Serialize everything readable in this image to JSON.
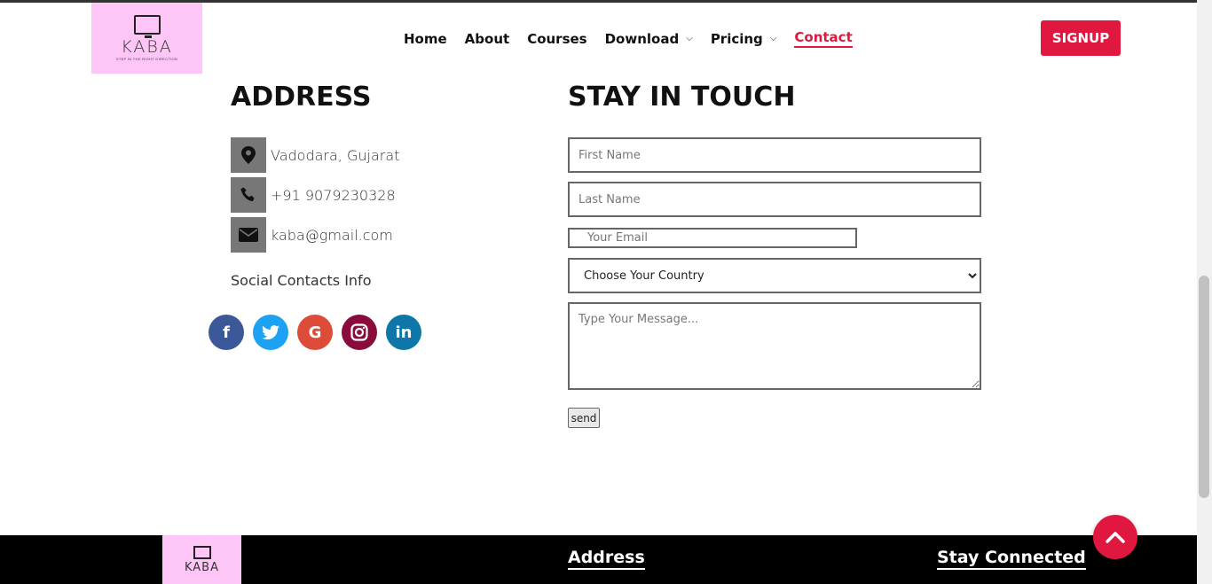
{
  "brand": {
    "name": "KABA",
    "tagline": "STEP IN THE RIGHT DIRECTION"
  },
  "nav": {
    "items": [
      {
        "label": "Home",
        "dropdown": false,
        "active": false
      },
      {
        "label": "About",
        "dropdown": false,
        "active": false
      },
      {
        "label": "Courses",
        "dropdown": false,
        "active": false
      },
      {
        "label": "Download",
        "dropdown": true,
        "active": false
      },
      {
        "label": "Pricing",
        "dropdown": true,
        "active": false
      },
      {
        "label": "Contact",
        "dropdown": false,
        "active": true
      }
    ],
    "signup_label": "SIGNUP"
  },
  "address": {
    "heading": "ADDRESS",
    "location": "Vadodara, Gujarat",
    "phone": "+91 9079230328",
    "email": "kaba@gmail.com",
    "social_label": "Social Contacts Info",
    "socials": [
      {
        "name": "facebook",
        "glyph": "f",
        "color": "#3b5998"
      },
      {
        "name": "twitter",
        "glyph": "t",
        "color": "#1da1f2"
      },
      {
        "name": "google",
        "glyph": "G",
        "color": "#dd4b39"
      },
      {
        "name": "instagram",
        "glyph": "◎",
        "color": "#8a0c3c"
      },
      {
        "name": "linkedin",
        "glyph": "in",
        "color": "#0e76a8"
      }
    ]
  },
  "form": {
    "heading": "STAY IN TOUCH",
    "first_name_placeholder": "First Name",
    "last_name_placeholder": "Last Name",
    "email_placeholder": "Your Email",
    "country_selected": "Choose Your Country",
    "message_placeholder": "Type Your Message...",
    "send_label": "send"
  },
  "footer": {
    "address_heading": "Address",
    "stay_connected_heading": "Stay Connected"
  },
  "colors": {
    "accent": "#e0183f",
    "logo_bg": "#fdc6f7"
  }
}
